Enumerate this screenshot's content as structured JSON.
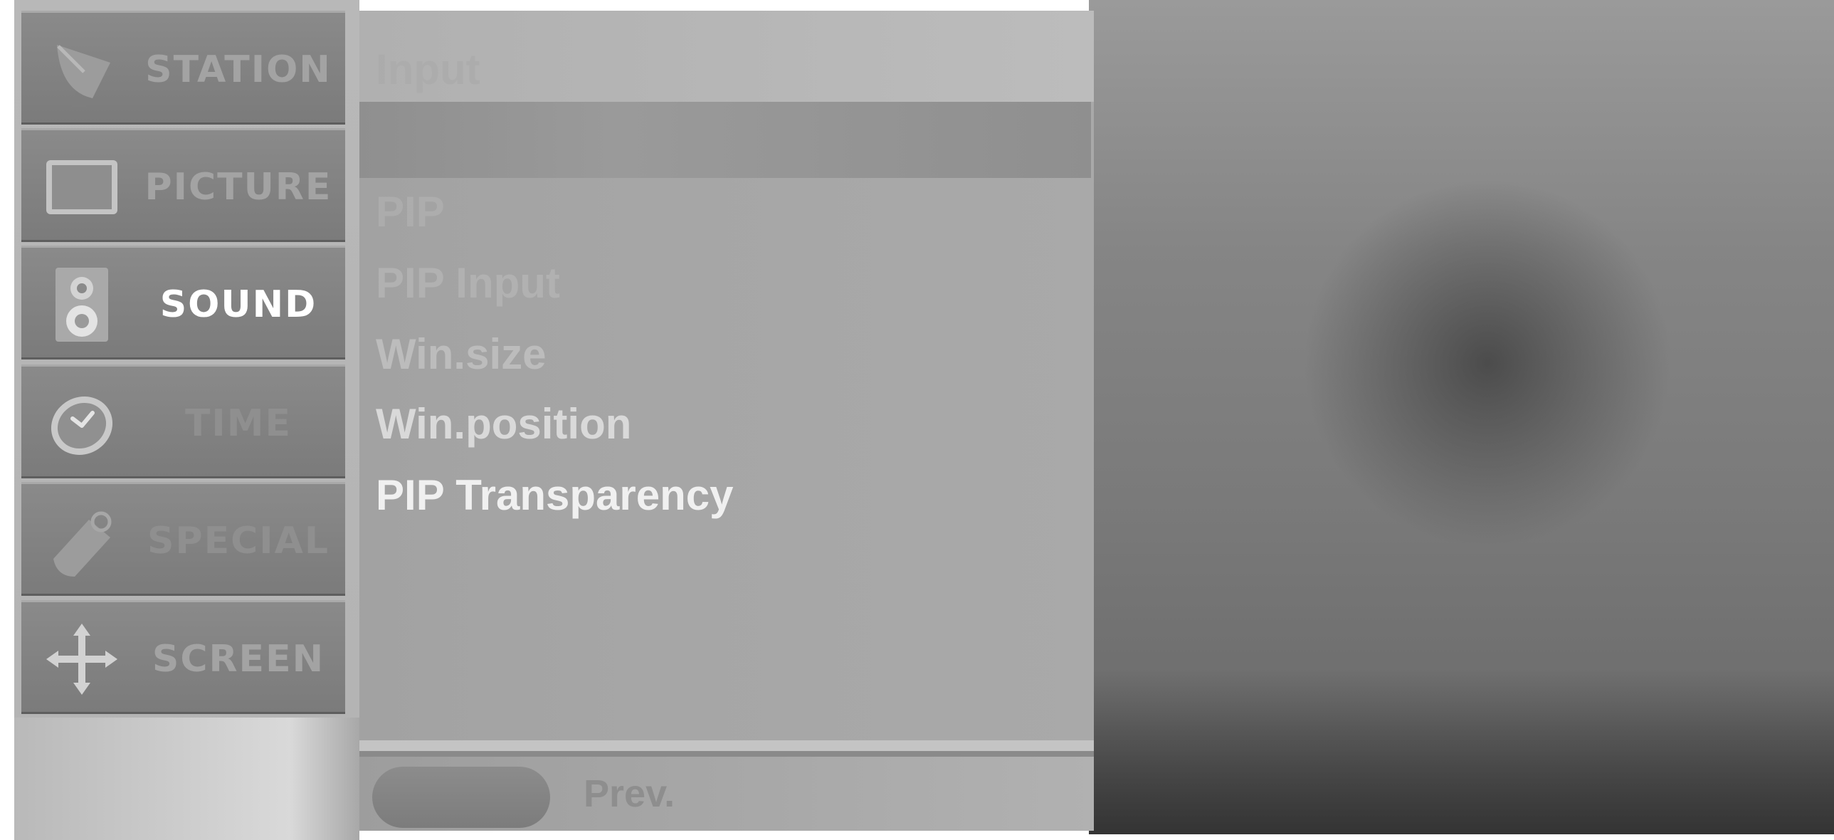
{
  "sidebar": {
    "tabs": [
      {
        "label": "STATION",
        "icon": "satellite-dish-icon",
        "state": "normal"
      },
      {
        "label": "PICTURE",
        "icon": "monitor-icon",
        "state": "normal"
      },
      {
        "label": "SOUND",
        "icon": "speaker-icon",
        "state": "selected"
      },
      {
        "label": "TIME",
        "icon": "clock-icon",
        "state": "dim"
      },
      {
        "label": "SPECIAL",
        "icon": "tag-icon",
        "state": "dim"
      },
      {
        "label": "SCREEN",
        "icon": "move-arrows-icon",
        "state": "normal"
      }
    ]
  },
  "menu": {
    "header": "Input",
    "items": [
      {
        "label": "PIP",
        "state": "disabled"
      },
      {
        "label": "PIP Input",
        "state": "disabled"
      },
      {
        "label": "Win.size",
        "state": "dim"
      },
      {
        "label": "Win.position",
        "state": "normal"
      },
      {
        "label": "PIP Transparency",
        "state": "bright"
      }
    ]
  },
  "footer": {
    "prev_label": "Prev."
  },
  "colors": {
    "selected_text": "#ffffff",
    "normal_text": "#a3a3a3",
    "tab_background": "#828282",
    "panel_background": "#a6a6a6"
  }
}
